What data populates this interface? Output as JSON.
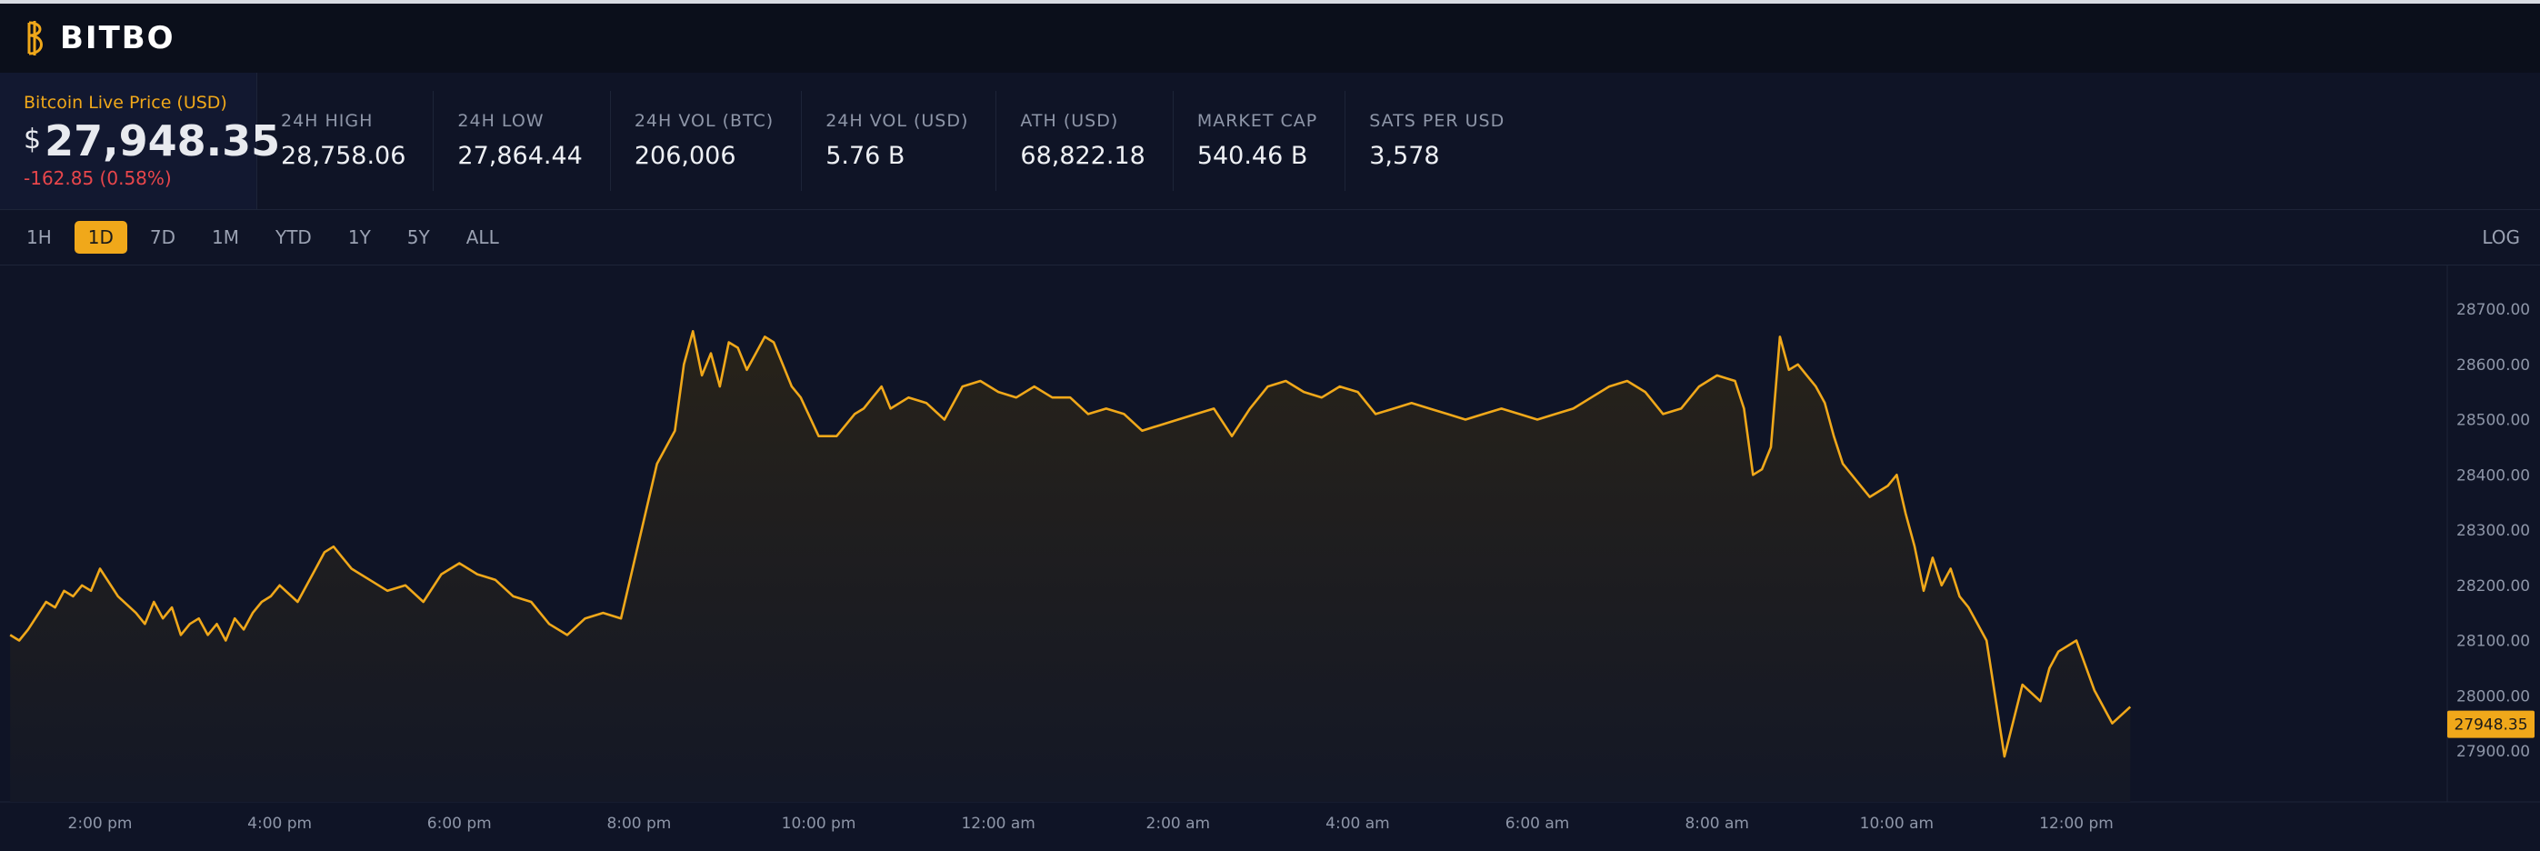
{
  "brand": {
    "name": "BITBO"
  },
  "live": {
    "label": "Bitcoin Live Price (USD)",
    "currency_symbol": "$",
    "price": "27,948.35",
    "change": "-162.85 (0.58%)"
  },
  "stats": [
    {
      "label": "24H HIGH",
      "value": "28,758.06"
    },
    {
      "label": "24H LOW",
      "value": "27,864.44"
    },
    {
      "label": "24H VOL (BTC)",
      "value": "206,006"
    },
    {
      "label": "24H VOL (USD)",
      "value": "5.76 B"
    },
    {
      "label": "ATH (USD)",
      "value": "68,822.18"
    },
    {
      "label": "MARKET CAP",
      "value": "540.46 B"
    },
    {
      "label": "SATS PER USD",
      "value": "3,578"
    }
  ],
  "ranges": [
    "1H",
    "1D",
    "7D",
    "1M",
    "YTD",
    "1Y",
    "5Y",
    "ALL"
  ],
  "active_range": "1D",
  "log_label": "LOG",
  "colors": {
    "accent": "#f0a81a",
    "negative": "#e8464b",
    "background": "#0f1426"
  },
  "chart_data": {
    "type": "area",
    "x_ticks": [
      "2:00 pm",
      "4:00 pm",
      "6:00 pm",
      "8:00 pm",
      "10:00 pm",
      "12:00 am",
      "2:00 am",
      "4:00 am",
      "6:00 am",
      "8:00 am",
      "10:00 am",
      "12:00 pm"
    ],
    "x_tick_hours": [
      2,
      4,
      6,
      8,
      10,
      12,
      14,
      16,
      18,
      20,
      22,
      24
    ],
    "y_ticks": [
      "28700.00",
      "28600.00",
      "28500.00",
      "28400.00",
      "28300.00",
      "28200.00",
      "28100.00",
      "28000.00",
      "27900.00"
    ],
    "ylim": [
      27870,
      28760
    ],
    "current_price_label": "27948.35",
    "current_price": 27948.35,
    "series": [
      {
        "x_hours": [
          1.0,
          1.1,
          1.2,
          1.4,
          1.5,
          1.6,
          1.7,
          1.8,
          1.9,
          2.0,
          2.2,
          2.4,
          2.5,
          2.6,
          2.7,
          2.8,
          2.9,
          3.0,
          3.1,
          3.2,
          3.3,
          3.4,
          3.5,
          3.6,
          3.7,
          3.8,
          3.9,
          4.0,
          4.2,
          4.4,
          4.5,
          4.6,
          4.7,
          4.8,
          5.0,
          5.2,
          5.4,
          5.6,
          5.8,
          6.0,
          6.2,
          6.4,
          6.6,
          6.8,
          7.0,
          7.2,
          7.4,
          7.6,
          7.8,
          8.0,
          8.2,
          8.4,
          8.5,
          8.6,
          8.7,
          8.8,
          8.9,
          9.0,
          9.1,
          9.2,
          9.3,
          9.4,
          9.5,
          9.6,
          9.7,
          9.8,
          10.0,
          10.2,
          10.4,
          10.5,
          10.6,
          10.7,
          10.8,
          11.0,
          11.2,
          11.4,
          11.6,
          11.8,
          12.0,
          12.2,
          12.4,
          12.6,
          12.8,
          13.0,
          13.2,
          13.4,
          13.6,
          13.8,
          14.0,
          14.2,
          14.4,
          14.6,
          14.8,
          15.0,
          15.2,
          15.4,
          15.6,
          15.8,
          16.0,
          16.2,
          16.4,
          16.6,
          16.8,
          17.0,
          17.2,
          17.4,
          17.6,
          17.8,
          18.0,
          18.2,
          18.4,
          18.6,
          18.8,
          19.0,
          19.2,
          19.4,
          19.6,
          19.8,
          20.0,
          20.2,
          20.3,
          20.4,
          20.5,
          20.6,
          20.7,
          20.8,
          20.9,
          21.0,
          21.1,
          21.2,
          21.3,
          21.4,
          21.5,
          21.6,
          21.7,
          21.8,
          21.9,
          22.0,
          22.1,
          22.2,
          22.3,
          22.4,
          22.5,
          22.6,
          22.7,
          22.8,
          22.9,
          23.0,
          23.2,
          23.4,
          23.6,
          23.7,
          23.8,
          24.0,
          24.2,
          24.4,
          24.6
        ],
        "values": [
          28110,
          28100,
          28120,
          28170,
          28160,
          28190,
          28180,
          28200,
          28190,
          28230,
          28180,
          28150,
          28130,
          28170,
          28140,
          28160,
          28110,
          28130,
          28140,
          28110,
          28130,
          28100,
          28140,
          28120,
          28150,
          28170,
          28180,
          28200,
          28170,
          28230,
          28260,
          28270,
          28250,
          28230,
          28210,
          28190,
          28200,
          28170,
          28220,
          28240,
          28220,
          28210,
          28180,
          28170,
          28130,
          28110,
          28140,
          28150,
          28140,
          28280,
          28420,
          28480,
          28600,
          28660,
          28580,
          28620,
          28560,
          28640,
          28630,
          28590,
          28620,
          28650,
          28640,
          28600,
          28560,
          28540,
          28470,
          28470,
          28510,
          28520,
          28540,
          28560,
          28520,
          28540,
          28530,
          28500,
          28560,
          28570,
          28550,
          28540,
          28560,
          28540,
          28540,
          28510,
          28520,
          28510,
          28480,
          28490,
          28500,
          28510,
          28520,
          28470,
          28520,
          28560,
          28570,
          28550,
          28540,
          28560,
          28550,
          28510,
          28520,
          28530,
          28520,
          28510,
          28500,
          28510,
          28520,
          28510,
          28500,
          28510,
          28520,
          28540,
          28560,
          28570,
          28550,
          28510,
          28520,
          28560,
          28580,
          28570,
          28520,
          28400,
          28410,
          28450,
          28650,
          28590,
          28600,
          28580,
          28560,
          28530,
          28470,
          28420,
          28400,
          28380,
          28360,
          28370,
          28380,
          28400,
          28330,
          28270,
          28190,
          28250,
          28200,
          28230,
          28180,
          28160,
          28130,
          28100,
          27890,
          28020,
          27990,
          28050,
          28080,
          28100,
          28010,
          27950,
          27980,
          27960,
          27960
        ]
      }
    ]
  }
}
